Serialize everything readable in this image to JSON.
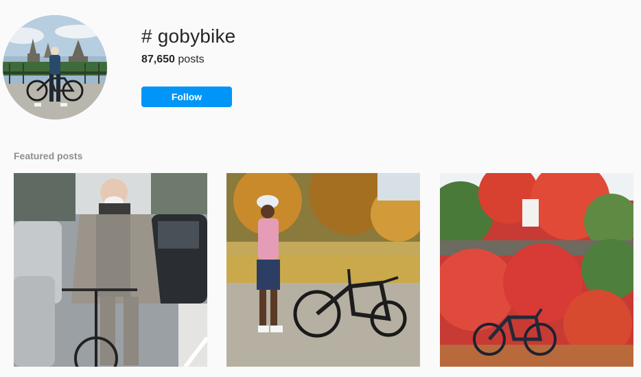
{
  "hashtag": {
    "title": "# gobybike",
    "posts_count": "87,650",
    "posts_label": "posts"
  },
  "actions": {
    "follow_label": "Follow"
  },
  "featured": {
    "heading": "Featured posts",
    "posts": [
      {
        "subject": "man in suit riding bicycle in city traffic"
      },
      {
        "subject": "cyclist in pink jersey standing beside road bike in autumn park"
      },
      {
        "subject": "road bike leaning against wall covered in red ivy"
      }
    ]
  },
  "colors": {
    "background": "#fafafa",
    "accent": "#0095f6",
    "text_primary": "#262626",
    "text_secondary": "#8e8e8e"
  }
}
